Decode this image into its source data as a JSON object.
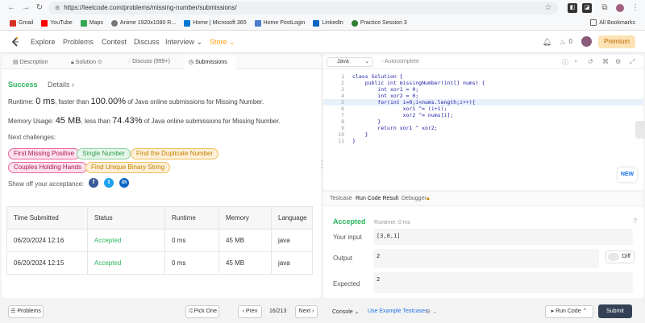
{
  "browser": {
    "url": "https://leetcode.com/problems/missing-number/submissions/",
    "bookmarks": [
      "Gmail",
      "YouTube",
      "Maps",
      "Anime 1920x1080 R...",
      "Home | Microsoft 365",
      "Home PostLogin",
      "LinkedIn",
      "Practice Session 3"
    ],
    "all_bookmarks": "All Bookmarks"
  },
  "nav": {
    "explore": "Explore",
    "problems": "Problems",
    "contest": "Contest",
    "discuss": "Discuss",
    "interview": "Interview ⌄",
    "store": "Store ⌄",
    "premium": "Premium",
    "fire_count": "0",
    "notify": "0"
  },
  "left_tabs": [
    "Description",
    "Solution",
    "Discuss (999+)",
    "Submissions"
  ],
  "result": {
    "status": "Success",
    "details": "Details ›",
    "runtime_pre": "Runtime: ",
    "runtime_val": "0 ms",
    "runtime_mid": ", faster than ",
    "runtime_pct": "100.00%",
    "runtime_post": " of Java online submissions for Missing Number.",
    "memory_pre": "Memory Usage: ",
    "memory_val": "45 MB",
    "memory_mid": ", less than ",
    "memory_pct": "74.43%",
    "memory_post": " of Java online submissions for Missing Number.",
    "next_challenges": "Next challenges:",
    "challenges": [
      "First Missing Positive",
      "Single Number",
      "Find the Duplicate Number",
      "Couples Holding Hands",
      "Find Unique Binary String"
    ],
    "share": "Show off your acceptance:"
  },
  "table": {
    "headers": [
      "Time Submitted",
      "Status",
      "Runtime",
      "Memory",
      "Language"
    ],
    "rows": [
      [
        "06/20/2024 12:16",
        "Accepted",
        "0 ms",
        "45 MB",
        "java"
      ],
      [
        "06/20/2024 12:15",
        "Accepted",
        "0 ms",
        "45 MB",
        "java"
      ]
    ]
  },
  "editor": {
    "language": "Java",
    "autocomplete": "Autocomplete",
    "lines": [
      "class Solution {",
      "    public int missingNumber(int[] nums) {",
      "        int xor1 = 0;",
      "        int xor2 = 0;",
      "        for(int i=0;i<nums.length;i++){",
      "                xor1 ^= (i+1);",
      "                xor2 ^= nums[i];",
      "        }",
      "        return xor1 ^ xor2;",
      "    }",
      "}"
    ],
    "new_badge": "NEW"
  },
  "console": {
    "tabs": [
      "Testcase",
      "Run Code Result",
      "Debugger"
    ],
    "status": "Accepted",
    "runtime": "Runtime: 0 ms",
    "your_input_label": "Your input",
    "your_input": "[3,0,1]",
    "output_label": "Output",
    "output": "2",
    "expected_label": "Expected",
    "expected": "2",
    "diff": "Diff"
  },
  "bottom": {
    "problems": "Problems",
    "pick_one": "Pick One",
    "prev": "‹ Prev",
    "page": "16/213",
    "next": "Next ›",
    "console": "Console ⌄",
    "use_example": "Use Example Testcases",
    "run_code": "Run Code ⌃",
    "submit": "Submit"
  }
}
